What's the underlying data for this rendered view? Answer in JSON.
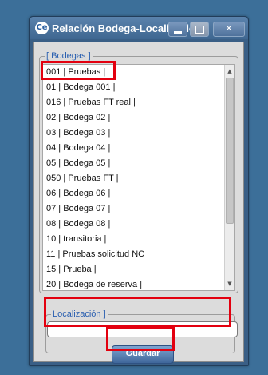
{
  "window": {
    "title": "Relación Bodega-Localización",
    "icon_label": "Ce",
    "close_label": "✕"
  },
  "bodegas": {
    "legend": "[ Bodegas ]",
    "items": [
      "001 | Pruebas |",
      "01 | Bodega 001 |",
      "016 | Pruebas FT real |",
      "02 | Bodega 02 |",
      "03 | Bodega 03 |",
      "04 | Bodega 04 |",
      "05 | Bodega 05 |",
      "050 | Pruebas FT |",
      "06 | Bodega 06 |",
      "07 | Bodega 07 |",
      "08 | Bodega 08 |",
      "10 | transitoria |",
      "11 | Pruebas solicitud NC |",
      "15 | Prueba |",
      "20 | Bodega de reserva |"
    ],
    "highlighted_item": "001 | Pruebas |",
    "scroll_up": "▲",
    "scroll_down": "▼"
  },
  "localizacion": {
    "legend": "Localización ]",
    "value": "",
    "placeholder": ""
  },
  "actions": {
    "save_label": "Guardar"
  },
  "colors": {
    "desktop": "#3c6f99",
    "accent": "#2a5fb0",
    "highlight": "#e3000f"
  }
}
